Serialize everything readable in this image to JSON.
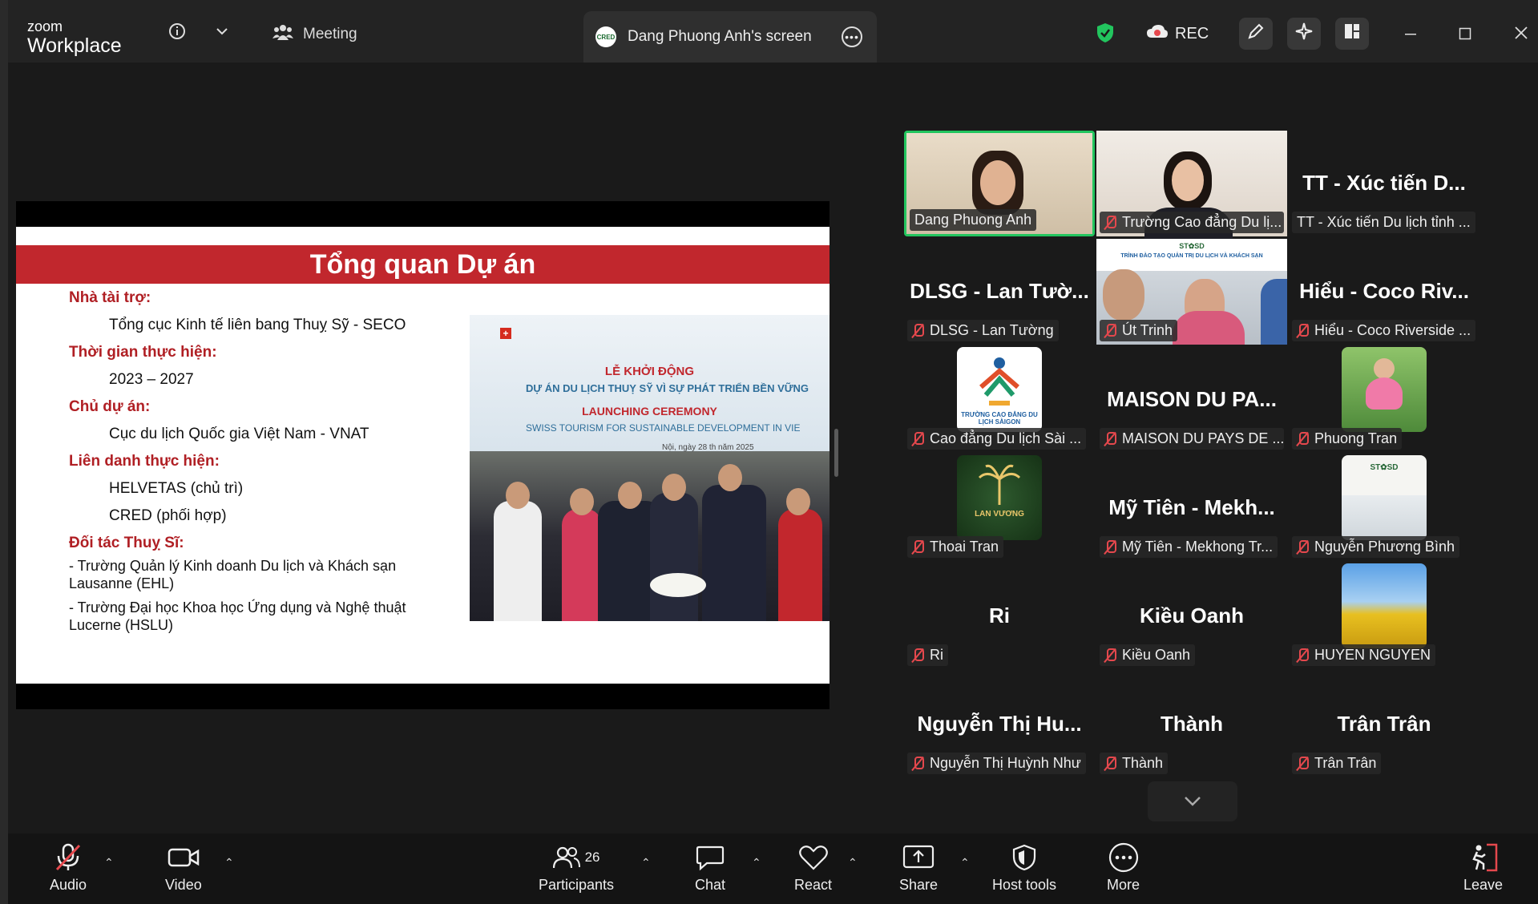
{
  "app": {
    "logo_top": "zoom",
    "logo_bottom": "Workplace"
  },
  "tabs": {
    "meeting": "Meeting",
    "screen_share": "Dang Phuong Anh's screen",
    "screen_badge": "CRED"
  },
  "topbar": {
    "rec": "REC"
  },
  "slide": {
    "title": "Tổng quan Dự án",
    "sections": [
      {
        "heading": "Nhà tài trợ:",
        "items": [
          "Tổng cục Kinh tế liên bang Thuỵ Sỹ - SECO"
        ]
      },
      {
        "heading": "Thời gian thực hiện:",
        "items": [
          "2023 – 2027"
        ]
      },
      {
        "heading": "Chủ dự án:",
        "items": [
          "Cục du lịch Quốc gia Việt Nam - VNAT"
        ]
      },
      {
        "heading": "Liên danh thực hiện:",
        "items": [
          "HELVETAS (chủ trì)",
          "CRED (phối hợp)"
        ]
      }
    ],
    "partners_heading": "Đối tác Thuỵ Sĩ:",
    "partners": [
      "- Trường Quản lý Kinh doanh Du lịch và Khách sạn Lausanne (EHL)",
      "- Trường Đại học Khoa học Ứng dụng và Nghệ thuật Lucerne (HSLU)"
    ],
    "photo": {
      "line1": "LỄ KHỞI ĐỘNG",
      "line2": "DỰ ÁN DU LỊCH THUỴ SỸ VÌ SỰ PHÁT TRIỂN BỀN VỮNG",
      "line3": "LAUNCHING CEREMONY",
      "line4": "SWISS TOURISM FOR SUSTAINABLE DEVELOPMENT IN VIE",
      "line5": "Nội, ngày 28 th      năm 2025"
    }
  },
  "participants": [
    {
      "big": "",
      "label": "Dang Phuong Anh",
      "muted": false,
      "active": true
    },
    {
      "big": "",
      "label": "Trường Cao đẳng Du lị...",
      "muted": true
    },
    {
      "big": "TT - Xúc tiến D...",
      "label": "TT - Xúc tiến Du lịch tỉnh ...",
      "muted": false
    },
    {
      "big": "DLSG - Lan Tườ...",
      "label": "DLSG - Lan Tường",
      "muted": true
    },
    {
      "big": "",
      "label": "Út Trinh",
      "muted": true
    },
    {
      "big": "Hiểu - Coco Riv...",
      "label": "Hiểu - Coco Riverside ...",
      "muted": true
    },
    {
      "big": "",
      "label": "Cao đẳng Du lịch Sài ...",
      "muted": true
    },
    {
      "big": "MAISON DU PA...",
      "label": "MAISON DU PAYS DE ...",
      "muted": true
    },
    {
      "big": "",
      "label": "Phuong Tran",
      "muted": true
    },
    {
      "big": "",
      "label": "Thoai Tran",
      "muted": true
    },
    {
      "big": "Mỹ Tiên - Mekh...",
      "label": "Mỹ Tiên - Mekhong Tr...",
      "muted": true
    },
    {
      "big": "",
      "label": "Nguyễn Phương Bình",
      "muted": true
    },
    {
      "big": "Ri",
      "label": "Ri",
      "muted": true
    },
    {
      "big": "Kiều Oanh",
      "label": "Kiều Oanh",
      "muted": true
    },
    {
      "big": "",
      "label": "HUYEN NGUYEN",
      "muted": true
    },
    {
      "big": "Nguyễn Thị Hu...",
      "label": "Nguyễn Thị Huỳnh Như",
      "muted": true
    },
    {
      "big": "Thành",
      "label": "Thành",
      "muted": true
    },
    {
      "big": "Trân Trân",
      "label": "Trân Trân",
      "muted": true
    }
  ],
  "avatar_texts": {
    "tile4_banner": "ST✿SD",
    "tile4_sub": "TRÌNH ĐÀO TẠO QUẢN TRỊ DU LỊCH VÀ KHÁCH SẠN",
    "tile6_caption": "TRƯỜNG CAO ĐẲNG DU LỊCH SÀIGON",
    "tile9_caption": "LAN VƯƠNG",
    "tile11_banner": "ST✿SD"
  },
  "toolbar": {
    "audio": "Audio",
    "video": "Video",
    "participants": "Participants",
    "participants_count": "26",
    "chat": "Chat",
    "react": "React",
    "share": "Share",
    "host_tools": "Host tools",
    "more": "More",
    "leave": "Leave"
  },
  "colors": {
    "active_border": "#22c55e",
    "muted_red": "#e5484d",
    "slide_red": "#c1272d"
  }
}
